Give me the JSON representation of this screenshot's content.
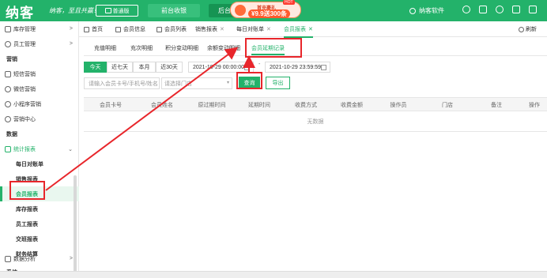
{
  "header": {
    "logo": "纳客",
    "slogan": "纳客，至且共赢！",
    "edition": "普通版",
    "nav_tabs": [
      "前台收银",
      "后台管理"
    ],
    "promo": {
      "line1": "首充豪礼",
      "line2": "¥9.9送300条",
      "badge": "HOT"
    },
    "user": "纳客软件"
  },
  "sidebar": {
    "items": [
      {
        "label": "库存管理",
        "icon": "inventory-icon",
        "arrow": ">"
      },
      {
        "label": "员工管理",
        "icon": "staff-icon",
        "arrow": ">"
      },
      {
        "label": "营销"
      },
      {
        "label": "短信营销",
        "icon": "sms-icon"
      },
      {
        "label": "微信营销",
        "icon": "wechat-icon"
      },
      {
        "label": "小程序营销",
        "icon": "miniprogram-icon"
      },
      {
        "label": "营销中心",
        "icon": "marketing-icon"
      },
      {
        "label": "数据"
      },
      {
        "label": "统计报表",
        "icon": "report-icon",
        "arrow": "⌄"
      },
      {
        "label": "每日对账单"
      },
      {
        "label": "销售报表"
      },
      {
        "label": "会员报表"
      },
      {
        "label": "库存报表"
      },
      {
        "label": "员工报表"
      },
      {
        "label": "交班报表"
      },
      {
        "label": "财务结算"
      },
      {
        "label": "数据分析",
        "icon": "analytics-icon",
        "arrow": ">"
      },
      {
        "label": "系统"
      }
    ]
  },
  "tabs": [
    {
      "label": "首页",
      "icon": "home-icon",
      "closable": false
    },
    {
      "label": "会员信息",
      "icon": "member-icon",
      "closable": false
    },
    {
      "label": "会员列表",
      "icon": "list-icon",
      "closable": false
    },
    {
      "label": "销售报表",
      "closable": true
    },
    {
      "label": "每日对账单",
      "closable": true
    },
    {
      "label": "会员报表",
      "closable": true,
      "active": true
    }
  ],
  "refresh_label": "刷新",
  "subtabs": [
    "充值明细",
    "充次明细",
    "积分变动明细",
    "余额变动明细",
    "会员延期记录"
  ],
  "filters": {
    "date_buttons": [
      "今天",
      "近七天",
      "本月",
      "近30天"
    ],
    "date_start": "2021-10-29 00:00:00",
    "date_end": "2021-10-29 23:59:59",
    "date_separator": "-",
    "search_placeholder": "请输入会员卡号/手机号/姓名",
    "store_placeholder": "请选择门店",
    "query_label": "查询",
    "export_label": "导出"
  },
  "table": {
    "columns": [
      "会员卡号",
      "会员姓名",
      "原过期时间",
      "延期时间",
      "收费方式",
      "收费金额",
      "操作员",
      "门店",
      "备注",
      "操作"
    ],
    "empty_text": "无数据"
  },
  "colors": {
    "accent": "#23b26a",
    "highlight": "#e8262b"
  }
}
